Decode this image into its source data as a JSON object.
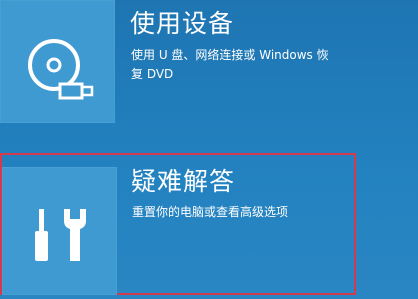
{
  "options": [
    {
      "title": "使用设备",
      "desc_line1": "使用 U 盘、网络连接或 Windows 恢",
      "desc_line2": "复 DVD",
      "icon": "disc-usb-icon"
    },
    {
      "title": "疑难解答",
      "desc_line1": "重置你的电脑或查看高级选项",
      "icon": "tools-icon",
      "selected": true
    }
  ],
  "colors": {
    "background": "#1f78b5",
    "tile": "#3e9ad0",
    "selection_border": "#d23a4e",
    "text": "#ffffff"
  }
}
